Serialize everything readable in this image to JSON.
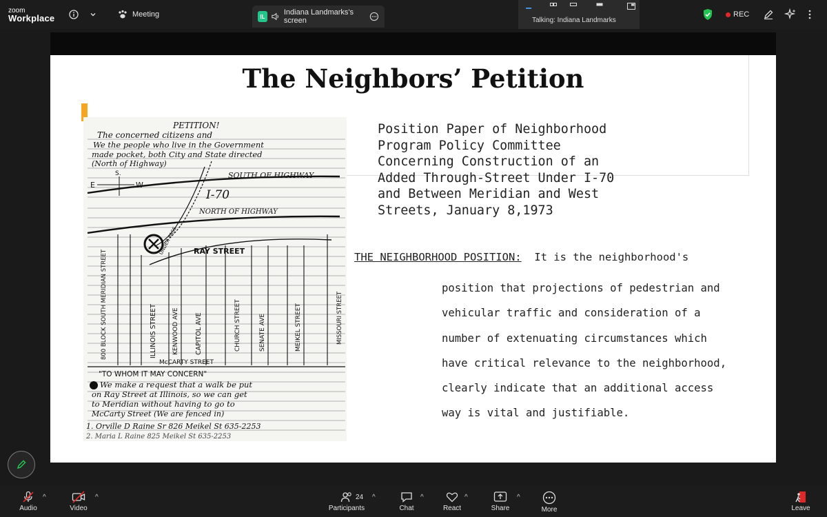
{
  "app": {
    "brand_line1": "zoom",
    "brand_line2": "Workplace"
  },
  "topbar": {
    "meeting_label": "Meeting",
    "share_tab": {
      "badge": "IL",
      "label": "Indiana Landmarks's screen"
    },
    "talking": "Talking: Indiana Landmarks",
    "rec_label": "REC"
  },
  "slide": {
    "title": "The Neighbors’ Petition",
    "position_paper": "Position Paper of Neighborhood\nProgram Policy Committee\nConcerning Construction of an\nAdded Through-Street Under I-70\nand Between Meridian and West\nStreets, January 8,1973",
    "heading": "THE NEIGHBORHOOD POSITION:",
    "heading_tail": "  It is the neighborhood's",
    "body": "position that projections of pedestrian and\nvehicular traffic and consideration of a\nnumber of extenuating circumstances which\nhave critical relevance to the neighborhood,\nclearly indicate that an additional access\nway is vital and justifiable.",
    "petition": {
      "petition_title": "PETITION!",
      "line1": "The concerned citizens and",
      "line2": "We the people who live in the Government",
      "line3": "made pocket, both City and State directed",
      "line4": "(North of Highway)",
      "south_of_highway": "SOUTH OF HIGHWAY",
      "i70": "I-70",
      "north_of_highway": "NORTH OF HIGHWAY",
      "ray_street": "RAY STREET",
      "under_pass": "UNDER PASS",
      "compass_s": "S.",
      "compass_e": "E",
      "compass_w": "W",
      "streets": [
        "800 BLOCK SOUTH MERIDIAN STREET",
        "ILLINOIS STREET",
        "KENWOOD AVE",
        "CAPITOL AVE",
        "CHURCH STREET",
        "SENATE AVE",
        "MEIKEL STREET",
        "MISSOURI STREET"
      ],
      "mccarty": "McCARTY STREET",
      "to_whom": "\"TO WHOM IT MAY CONCERN\"",
      "request1": "We make a request that a walk be put",
      "request2": "on Ray Street at Illinois, so we can get",
      "request3": "to Meridian without having to go to",
      "request4": "McCarty Street (We are fenced in)",
      "sig1": "1. Orville D Raine Sr   826 Meikel St  635-2253",
      "sig2": "2. Maria L Raine   825 Meikel St  635-2253"
    }
  },
  "bottombar": {
    "audio": "Audio",
    "video": "Video",
    "participants": "Participants",
    "participants_count": "24",
    "chat": "Chat",
    "react": "React",
    "share": "Share",
    "more": "More",
    "leave": "Leave"
  },
  "colors": {
    "accent_orange": "#f6a623",
    "rec_red": "#e02828",
    "shield_green": "#23c552",
    "leave_red": "#e02828"
  }
}
